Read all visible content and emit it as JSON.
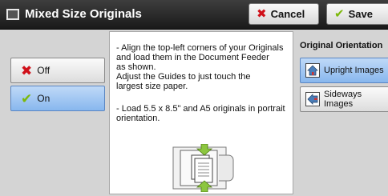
{
  "header": {
    "title": "Mixed Size Originals",
    "cancel_label": "Cancel",
    "save_label": "Save"
  },
  "options": {
    "off_label": "Off",
    "on_label": "On",
    "selected": "On"
  },
  "guide": {
    "text1": "- Align the top-left corners of your Originals\n  and load them in the Document Feeder\n  as shown.\n  Adjust the Guides to just touch the\n  largest size paper.",
    "text2": "- Load 5.5 x 8.5\" and A5 originals in portrait\n  orientation."
  },
  "orientation": {
    "label": "Original Orientation",
    "upright_label": "Upright Images",
    "sideways_label": "Sideways\nImages",
    "selected": "Upright Images"
  },
  "icons": {
    "cancel": "red-x-icon",
    "save": "green-check-icon",
    "off": "red-x-icon",
    "on": "green-check-icon",
    "upright": "upright-house-icon",
    "sideways": "sideways-house-icon"
  },
  "colors": {
    "header_bg": "#2b2b2b",
    "selected_bg": "#9cc4f2",
    "cancel_x": "#d0111a",
    "check": "#7cb80a"
  }
}
